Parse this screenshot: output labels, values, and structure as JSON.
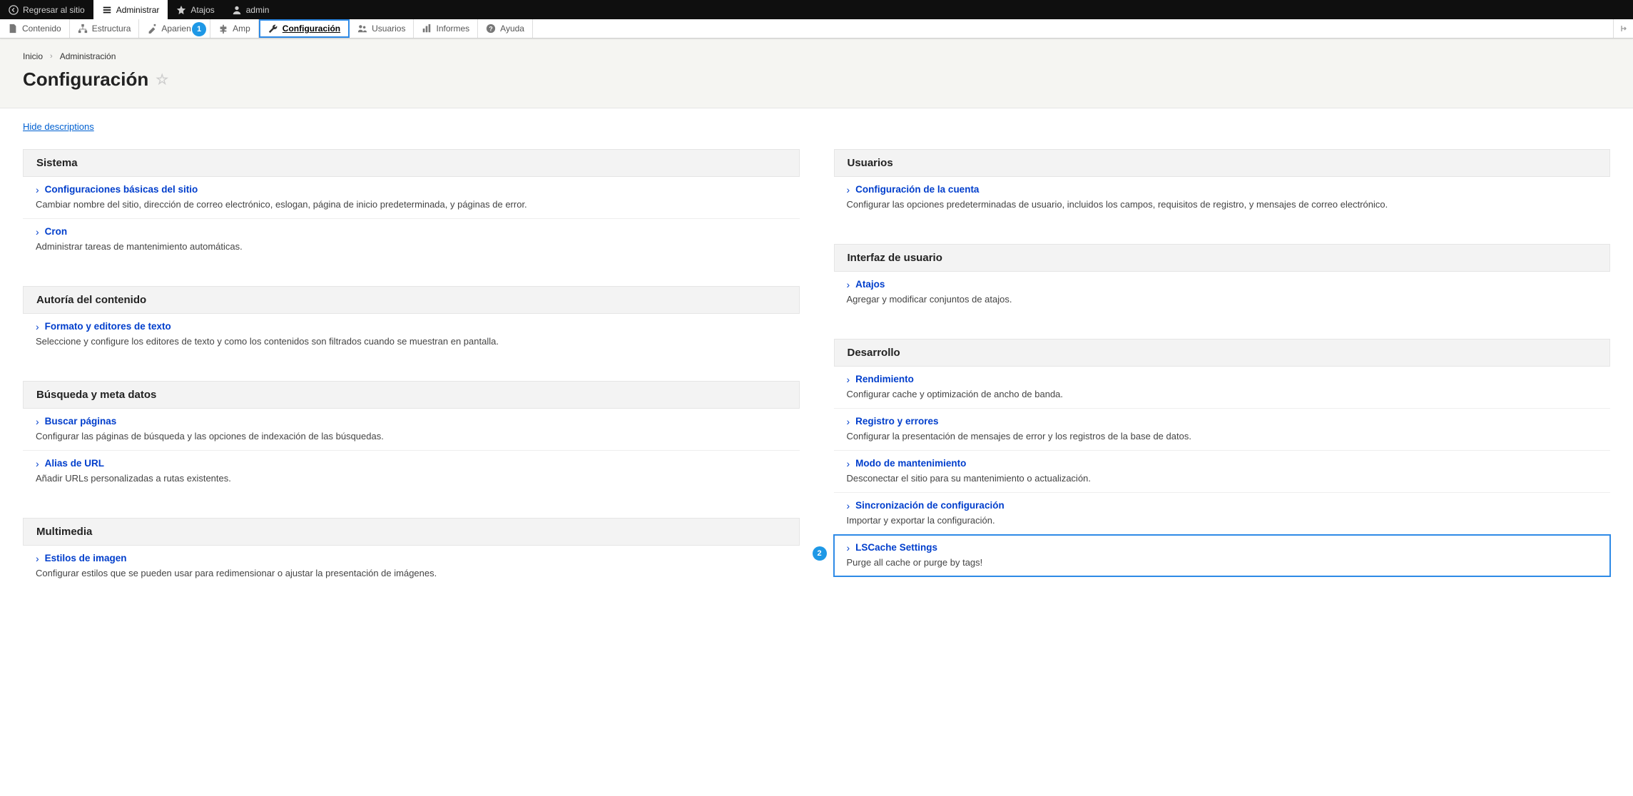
{
  "topbar": {
    "back": "Regresar al sitio",
    "manage": "Administrar",
    "shortcuts": "Atajos",
    "user": "admin"
  },
  "admin_tabs": {
    "contenido": "Contenido",
    "estructura": "Estructura",
    "apariencia": "Apariencia",
    "ampliar": "Amp",
    "configuracion": "Configuración",
    "usuarios": "Usuarios",
    "informes": "Informes",
    "ayuda": "Ayuda"
  },
  "breadcrumb": {
    "home": "Inicio",
    "admin": "Administración"
  },
  "page_title": "Configuración",
  "hide_descriptions": "Hide descriptions",
  "left": {
    "sistema": {
      "title": "Sistema",
      "items": [
        {
          "label": "Configuraciones básicas del sitio",
          "desc": "Cambiar nombre del sitio, dirección de correo electrónico, eslogan, página de inicio predeterminada, y páginas de error."
        },
        {
          "label": "Cron",
          "desc": "Administrar tareas de mantenimiento automáticas."
        }
      ]
    },
    "autoria": {
      "title": "Autoría del contenido",
      "items": [
        {
          "label": "Formato y editores de texto",
          "desc": "Seleccione y configure los editores de texto y como los contenidos son filtrados cuando se muestran en pantalla."
        }
      ]
    },
    "busqueda": {
      "title": "Búsqueda y meta datos",
      "items": [
        {
          "label": "Buscar páginas",
          "desc": "Configurar las páginas de búsqueda y las opciones de indexación de las búsquedas."
        },
        {
          "label": "Alias de URL",
          "desc": "Añadir URLs personalizadas a rutas existentes."
        }
      ]
    },
    "multimedia": {
      "title": "Multimedia",
      "items": [
        {
          "label": "Estilos de imagen",
          "desc": "Configurar estilos que se pueden usar para redimensionar o ajustar la presentación de imágenes."
        }
      ]
    }
  },
  "right": {
    "usuarios": {
      "title": "Usuarios",
      "items": [
        {
          "label": "Configuración de la cuenta",
          "desc": "Configurar las opciones predeterminadas de usuario, incluidos los campos, requisitos de registro, y mensajes de correo electrónico."
        }
      ]
    },
    "interfaz": {
      "title": "Interfaz de usuario",
      "items": [
        {
          "label": "Atajos",
          "desc": "Agregar y modificar conjuntos de atajos."
        }
      ]
    },
    "desarrollo": {
      "title": "Desarrollo",
      "items": [
        {
          "label": "Rendimiento",
          "desc": "Configurar cache y optimización de ancho de banda."
        },
        {
          "label": "Registro y errores",
          "desc": "Configurar la presentación de mensajes de error y los registros de la base de datos."
        },
        {
          "label": "Modo de mantenimiento",
          "desc": "Desconectar el sitio para su mantenimiento o actualización."
        },
        {
          "label": "Sincronización de configuración",
          "desc": "Importar y exportar la configuración."
        },
        {
          "label": "LSCache Settings",
          "desc": "Purge all cache or purge by tags!"
        }
      ]
    }
  },
  "annotations": {
    "one": "1",
    "two": "2"
  }
}
